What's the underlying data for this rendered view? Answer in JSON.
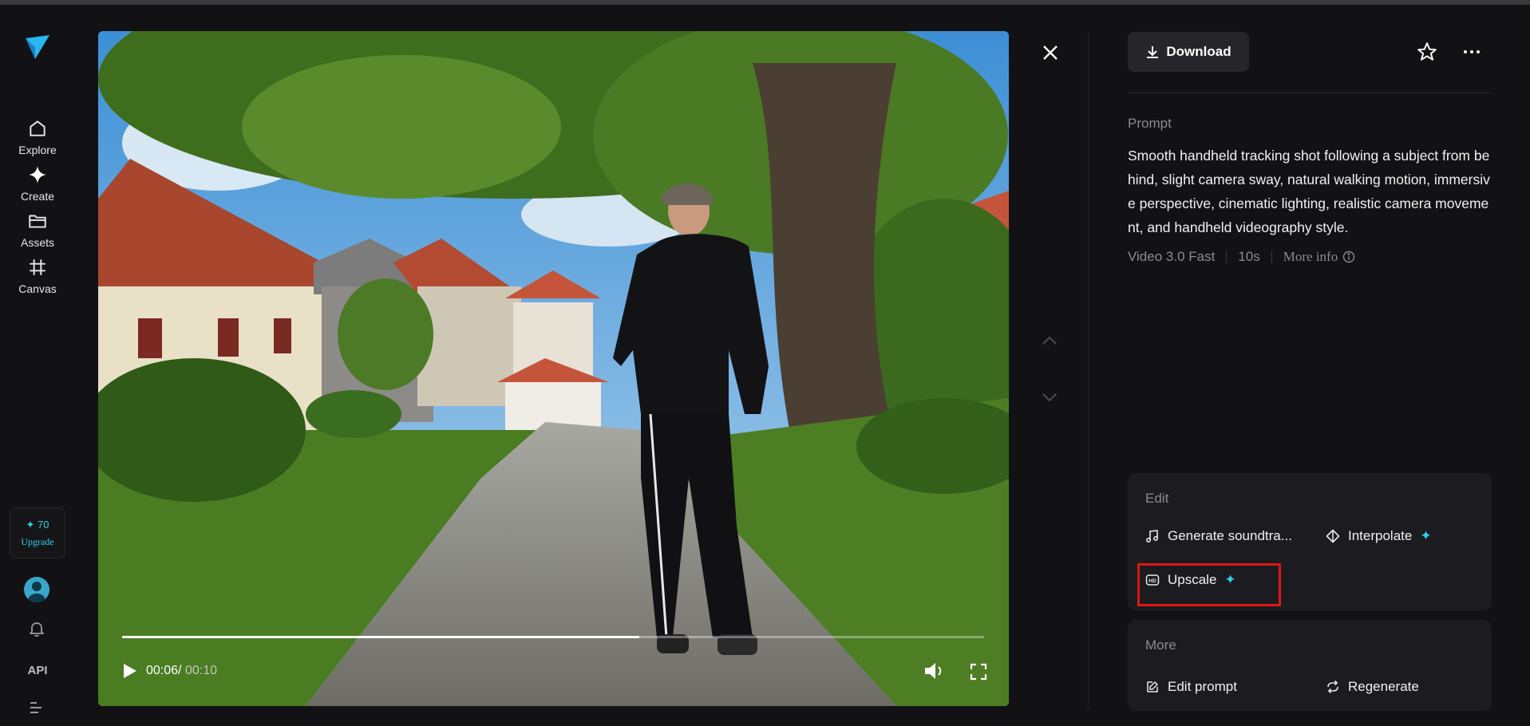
{
  "sidebar": {
    "items": [
      {
        "label": "Explore",
        "icon": "home-icon"
      },
      {
        "label": "Create",
        "icon": "sparkle-icon"
      },
      {
        "label": "Assets",
        "icon": "folder-icon"
      },
      {
        "label": "Canvas",
        "icon": "canvas-icon"
      }
    ],
    "credits": {
      "value": "✦ 70",
      "upgrade_label": "Upgrade"
    },
    "api_label": "API"
  },
  "player": {
    "current_time": "00:06",
    "duration": "00:10",
    "time_separator": "/",
    "progress_fraction": 0.6
  },
  "toolbar": {
    "download_label": "Download"
  },
  "prompt": {
    "heading": "Prompt",
    "text": "Smooth handheld tracking shot following a subject from behind, slight camera sway, natural walking motion, immersive perspective, cinematic lighting, realistic camera movement, and handheld videography style.",
    "model": "Video 3.0 Fast",
    "length": "10s",
    "more_info_label": "More info"
  },
  "edit_section": {
    "heading": "Edit",
    "actions": [
      {
        "label": "Generate soundtra...",
        "icon": "music-note-icon"
      },
      {
        "label": "Interpolate",
        "icon": "interpolate-icon",
        "premium": "✦"
      },
      {
        "label": "Upscale",
        "icon": "hd-icon",
        "premium": "✦",
        "highlighted": true
      }
    ]
  },
  "more_section": {
    "heading": "More",
    "actions": [
      {
        "label": "Edit prompt",
        "icon": "edit-icon"
      },
      {
        "label": "Regenerate",
        "icon": "refresh-icon"
      }
    ]
  },
  "colors": {
    "background": "#121214",
    "card": "#1c1c20",
    "accent": "#2bd1f0",
    "highlight": "#e01515"
  }
}
